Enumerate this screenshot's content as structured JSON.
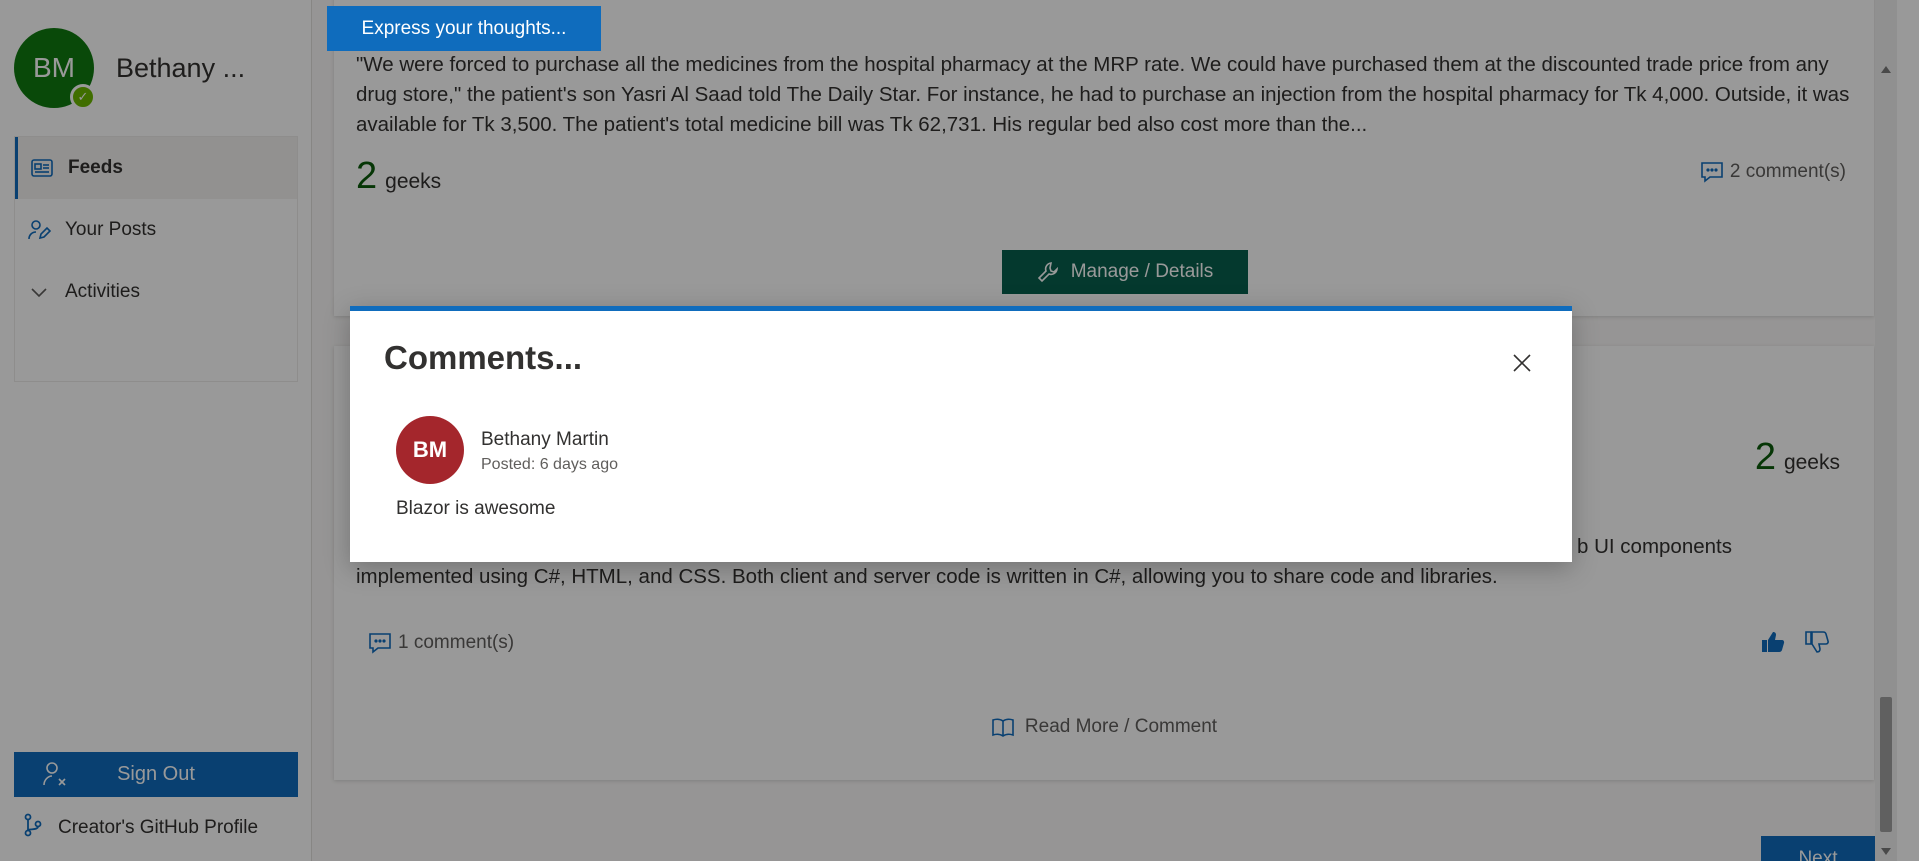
{
  "sidebar": {
    "user": {
      "initials": "BM",
      "name": "Bethany ...",
      "status_color": "#6bb700",
      "avatar_color": "#0f7a0f"
    },
    "nav": [
      {
        "label": "Feeds",
        "icon": "feed-icon",
        "active": true
      },
      {
        "label": "Your Posts",
        "icon": "person-edit-icon",
        "active": false
      },
      {
        "label": "Activities",
        "icon": "chevron-down-icon",
        "active": false
      }
    ],
    "sign_out_label": "Sign Out",
    "github_label": "Creator's GitHub Profile"
  },
  "main": {
    "express_button_label": "Express your thoughts...",
    "post1": {
      "text": "\"We were forced to purchase all the medicines from the hospital pharmacy at the MRP rate. We could have purchased them at the discounted trade price from any drug store,\" the patient's son Yasri Al Saad told The Daily Star. For instance, he had to purchase an injection from the hospital pharmacy for Tk 4,000. Outside, it was available for Tk 3,500. The patient's total medicine bill was Tk 62,731. His regular bed also cost more than the...",
      "geeks_count": "2",
      "geeks_label": "geeks",
      "comments_label": "2 comment(s)",
      "manage_label": "Manage / Details"
    },
    "post2": {
      "geeks_count": "2",
      "geeks_label": "geeks",
      "text_line1": "b UI components",
      "text_line2": "implemented using C#, HTML, and CSS. Both client and server code is written in C#, allowing you to share code and libraries.",
      "comments_label": "1 comment(s)",
      "read_more_label": "Read More / Comment"
    },
    "next_label": "Next"
  },
  "dialog": {
    "title": "Comments...",
    "comment": {
      "initials": "BM",
      "author": "Bethany Martin",
      "posted": "Posted: 6 days ago",
      "text": "Blazor is awesome"
    }
  },
  "colors": {
    "accent": "#0f6cbd",
    "manage_button": "#07604e",
    "comment_avatar": "#a4262c",
    "geeks_number": "#0b5a0b"
  }
}
